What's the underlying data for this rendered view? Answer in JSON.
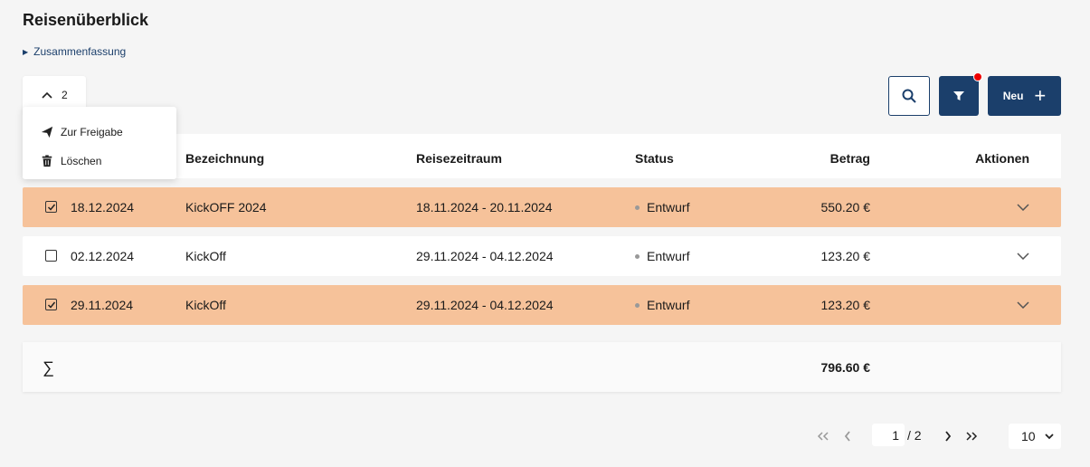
{
  "page": {
    "title": "Reisenüberblick",
    "summary_link": "Zusammenfassung"
  },
  "selection": {
    "count": "2",
    "actions": [
      {
        "label": "Zur Freigabe",
        "icon": "send-icon"
      },
      {
        "label": "Löschen",
        "icon": "trash-icon"
      }
    ]
  },
  "toolbar": {
    "new_label": "Neu",
    "filter_active": true,
    "accent_color": "#1b3f6b",
    "badge_color": "#e00000"
  },
  "table": {
    "columns": [
      "Bezeichnung",
      "Reisezeitraum",
      "Status",
      "Betrag",
      "Aktionen"
    ],
    "rows": [
      {
        "date": "18.12.2024",
        "name": "KickOFF 2024",
        "period": "18.11.2024 - 20.11.2024",
        "status": "Entwurf",
        "amount": "550.20 €",
        "selected": true
      },
      {
        "date": "02.12.2024",
        "name": "KickOff",
        "period": "29.11.2024 - 04.12.2024",
        "status": "Entwurf",
        "amount": "123.20 €",
        "selected": false
      },
      {
        "date": "29.11.2024",
        "name": "KickOff",
        "period": "29.11.2024 - 04.12.2024",
        "status": "Entwurf",
        "amount": "123.20 €",
        "selected": true
      }
    ],
    "selected_color": "#f6c29a",
    "sum_symbol": "∑",
    "sum_total": "796.60 €"
  },
  "pagination": {
    "current_page": "1",
    "total_pages": "/ 2",
    "per_page": "10"
  }
}
